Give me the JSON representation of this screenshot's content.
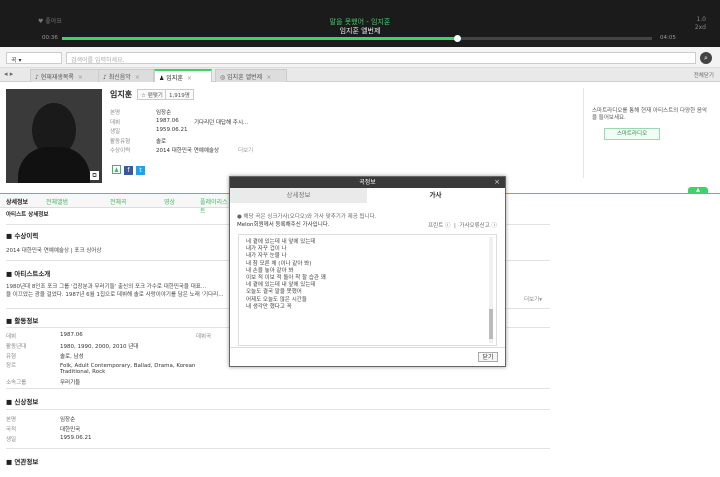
{
  "player": {
    "song": "말을 못했어 - 임지훈",
    "album": "임지훈 엘번제",
    "time_cur": "00:36",
    "time_total": "04:05",
    "progress": 0.67,
    "vol_top": "1.0",
    "vol_bottom": "2xd",
    "ctl_text": "♥ 좋아요"
  },
  "search": {
    "category": "곡",
    "placeholder": "검색어를 입력하세요."
  },
  "tabs": [
    {
      "label": "현재재생목록"
    },
    {
      "label": "최신음악"
    },
    {
      "label": "임지훈"
    },
    {
      "label": "임지훈 엘번제"
    }
  ],
  "tabs_right": "전체닫기",
  "artist": {
    "name": "임지훈",
    "fan_label": "팬맺기",
    "fan_count": "1,919명",
    "info": [
      {
        "k": "본명",
        "v": "임장순",
        "extra": ""
      },
      {
        "k": "데뷔",
        "v": "1987.06",
        "extra": "기다리던 대답해 주시..."
      },
      {
        "k": "생일",
        "v": "1959.06.21",
        "extra": ""
      },
      {
        "k": "활동유형",
        "v": "솔로",
        "extra": ""
      },
      {
        "k": "수상이력",
        "v": "2014 대한민국 연예예술상",
        "extra": "더보기"
      }
    ]
  },
  "side_text": "스마트라디오를 통해 현재 아티스트의 다양한 음악을 들어보세요.",
  "side_btn": "스마트라디오",
  "subtabs": [
    "상세정보",
    "전체앨범",
    "전체곡",
    "영상",
    "플레이리스트"
  ],
  "content": {
    "title": "아티스트 상세정보",
    "award_h": "수상이력",
    "award_t": "2014 대한민국 연예예술상 | 포크 싱어상",
    "intro_h": "아티스트소개",
    "intro_t1": "1980년대 8인조 포크 그룹 '겁장분과 무러기들' 출신의 포크 가수로 대한민국을 대표...",
    "intro_t2": "을 이끄었는 광을 걸었다. 1987년 6월 1집으로 데뷔해 솔로 사랑이야기를 담은 노래 '기다리...",
    "intro_more": "더보기",
    "activity_h": "활동정보",
    "activity": [
      {
        "k": "데뷔",
        "v": "1987.06",
        "k2": "데뷔곡"
      },
      {
        "k": "활동년대",
        "v": "1980, 1990, 2000, 2010 년대",
        "k2": ""
      },
      {
        "k": "유형",
        "v": "솔로, 남성",
        "k2": ""
      },
      {
        "k": "장르",
        "v": "Folk, Adult Contemporary, Ballad, Drama, Korean Traditional, Rock",
        "k2": ""
      },
      {
        "k": "소속그룹",
        "v": "무러기들",
        "k2": ""
      }
    ],
    "personal_h": "신상정보",
    "personal": [
      {
        "k": "본명",
        "v": "임장순"
      },
      {
        "k": "국적",
        "v": "대한민국"
      },
      {
        "k": "생일",
        "v": "1959.06.21"
      }
    ],
    "related_h": "연관정보"
  },
  "modal": {
    "title": "곡정보",
    "tab1": "상세정보",
    "tab2": "가사",
    "note1": "● 해당 곡은 싱크가사(오디오)와 가사 맞추기가 제공 됩니다.",
    "note2": "Melon회원께서 등록해주신 가사입니다.",
    "tool1": "프린트 ⓘ",
    "tool2": "가사오류신고 ⓘ",
    "lyrics": [
      "네 곁에 있는데 내 앞에 있는데",
      "내가 자꾸 겁이 나",
      "내가 자꾸 눈물 나",
      "내 참 모른 체 (이나 같아 봐)",
      "내 손을 놓아 같아 봐",
      "이보 적 이보 적 돌아 착 할 습관 꽤",
      "네 곁에 있는데 내 앞에 있는데",
      "오늘도 결국 말을 못했어",
      "어제도 오늘도 많은 시간들",
      "내 생각만 했다고 꼭"
    ],
    "close": "닫기"
  }
}
